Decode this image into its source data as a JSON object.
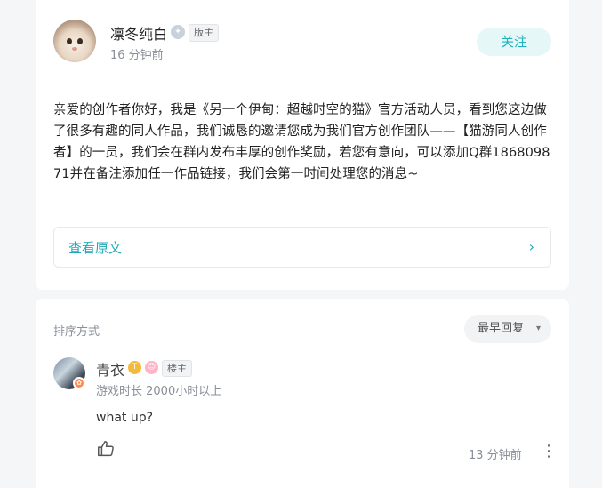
{
  "post": {
    "author": "凛冬纯白",
    "role_tag": "版主",
    "time": "16 分钟前",
    "follow_label": "关注",
    "body": "亲爱的创作者你好，我是《另一个伊甸：超越时空的猫》官方活动人员，看到您这边做了很多有趣的同人作品，我们诚恳的邀请您成为我们官方创作团队——【猫游同人创作者】的一员，我们会在群内发布丰厚的创作奖励，若您有意向，可以添加Q群186809871并在备注添加任一作品链接，我们会第一时间处理您的消息~",
    "view_original_label": "查看原文"
  },
  "comments": {
    "sort_label": "排序方式",
    "sort_value": "最早回复",
    "items": [
      {
        "name": "青衣",
        "tag": "楼主",
        "playtime": "游戏时长 2000小时以上",
        "text": "what up?",
        "time": "13 分钟前"
      }
    ]
  },
  "icons": {
    "chevron_right": "›",
    "caret_down": "▾",
    "more": "⋮"
  },
  "colors": {
    "accent": "#20b2bd",
    "accent_bg": "#e6f7f8",
    "muted_text": "#8a8f99"
  }
}
